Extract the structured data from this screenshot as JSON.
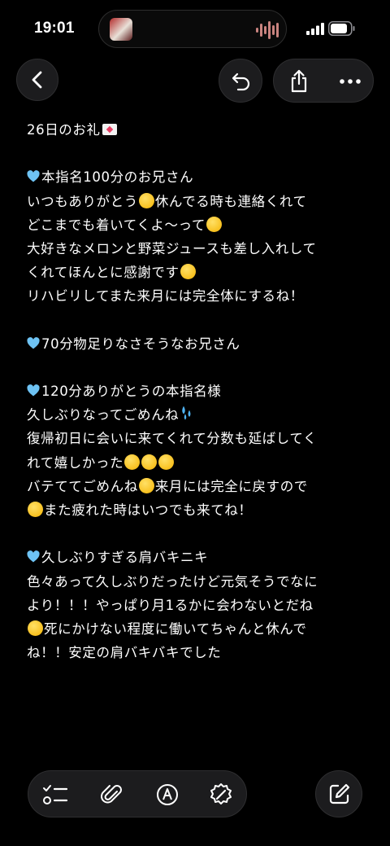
{
  "status_bar": {
    "time": "19:01"
  },
  "note": {
    "lines": [
      [
        "26日のお礼",
        {
          "e": "envelope"
        }
      ],
      [],
      [
        {
          "e": "heart"
        },
        "本指名100分のお兄さん"
      ],
      [
        "いつもありがとう",
        {
          "e": "tear"
        },
        "休んでる時も連絡くれて"
      ],
      [
        "どこまでも着いてくよ〜って",
        {
          "e": "cry"
        }
      ],
      [
        "大好きなメロンと野菜ジュースも差し入れして"
      ],
      [
        "くれてほんとに感謝です",
        {
          "e": "relieved"
        }
      ],
      [
        "リハビリしてまた来月には完全体にするね！"
      ],
      [],
      [
        {
          "e": "heart"
        },
        "70分物足りなさそうなお兄さん"
      ],
      [],
      [
        {
          "e": "heart"
        },
        "120分ありがとうの本指名様"
      ],
      [
        "久しぶりなってごめんね",
        {
          "e": "sweat"
        }
      ],
      [
        "復帰初日に会いに来てくれて分数も延ばしてく"
      ],
      [
        "れて嬉しかった",
        {
          "e": "cry"
        },
        {
          "e": "cry"
        },
        {
          "e": "cry"
        }
      ],
      [
        "バテててごめんね",
        {
          "e": "tear"
        },
        "来月には完全に戻すので"
      ],
      [
        {
          "e": "nomouth"
        },
        "また疲れた時はいつでも来てね！"
      ],
      [],
      [
        {
          "e": "heart"
        },
        "久しぶりすぎる肩バキニキ"
      ],
      [
        "色々あって久しぶりだったけど元気そうでなに"
      ],
      [
        "より！！！やっぱり月1るかに会わないとだね"
      ],
      [
        {
          "e": "joy"
        },
        "死にかけない程度に働いてちゃんと休んで"
      ],
      [
        "ね！！安定の肩バキバキでした"
      ]
    ]
  },
  "colors": {
    "background": "#000000",
    "button_bg": "#1c1c1e",
    "heart": "#6ec3f4"
  },
  "icons": {
    "back": "chevron-left-icon",
    "undo": "undo-icon",
    "share": "share-icon",
    "more": "more-icon",
    "checklist": "checklist-icon",
    "attach": "paperclip-icon",
    "markup": "pen-markup-icon",
    "ai": "writing-tools-icon",
    "compose": "compose-icon"
  }
}
